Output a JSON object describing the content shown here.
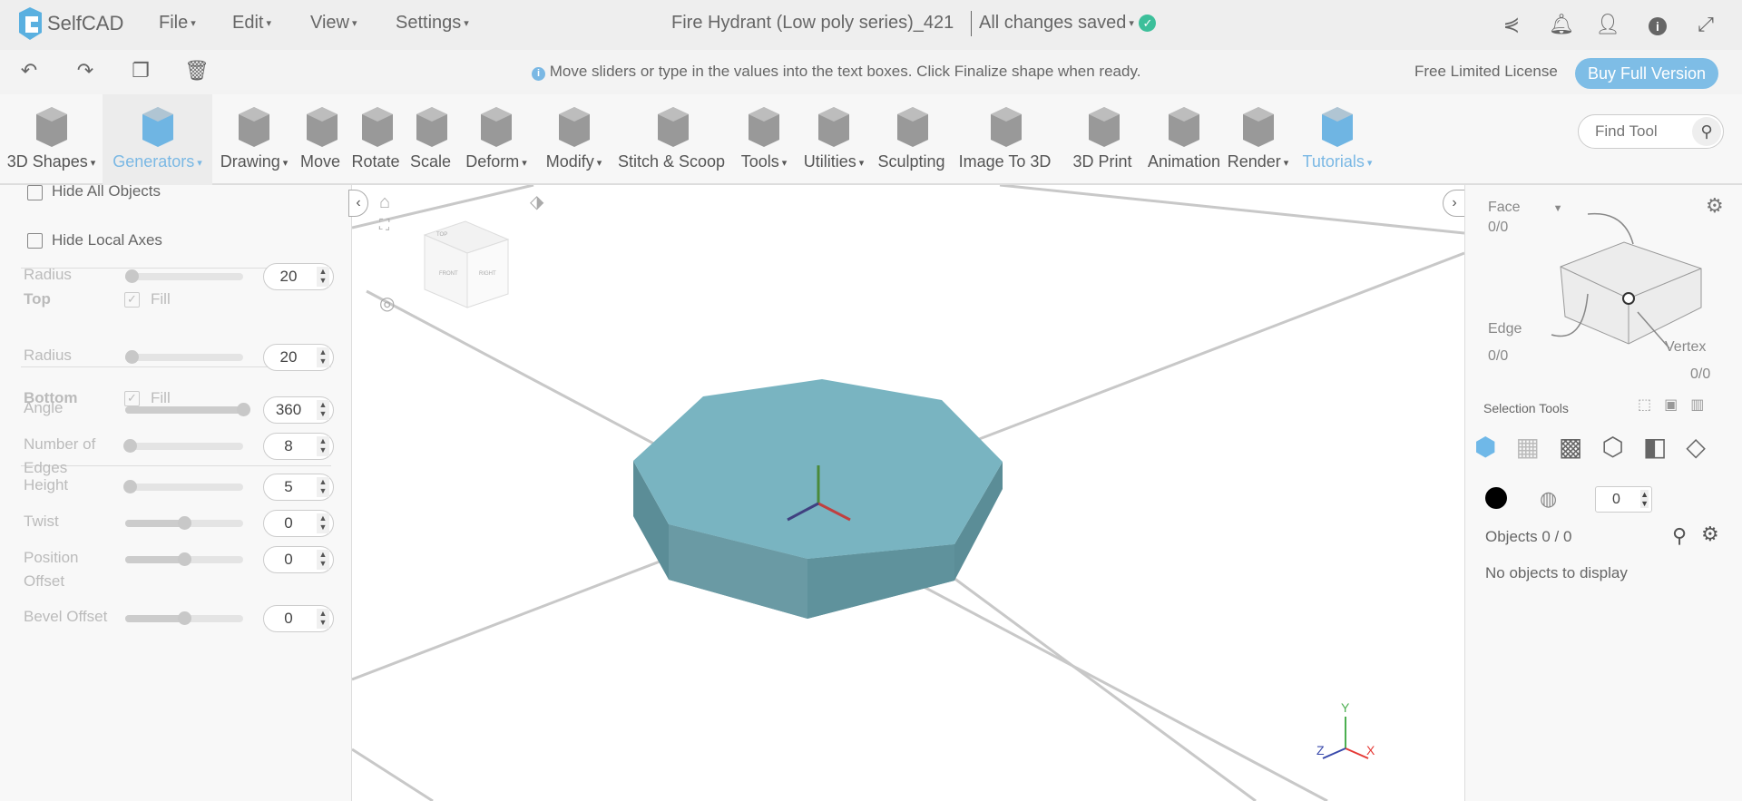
{
  "header": {
    "logo": "SelfCAD",
    "menus": [
      "File",
      "Edit",
      "View",
      "Settings"
    ],
    "doc_title": "Fire Hydrant (Low poly series)_421",
    "save_status": "All changes saved"
  },
  "subbar": {
    "hint": "Move sliders or type in the values into the text boxes. Click Finalize shape when ready.",
    "license": "Free Limited License",
    "buy": "Buy Full Version"
  },
  "toolbar": {
    "tools": [
      {
        "label": "3D Shapes",
        "dd": "▾"
      },
      {
        "label": "Generators",
        "dd": "▾"
      },
      {
        "label": "Drawing",
        "dd": "▾"
      },
      {
        "label": "Move",
        "dd": ""
      },
      {
        "label": "Rotate",
        "dd": ""
      },
      {
        "label": "Scale",
        "dd": ""
      },
      {
        "label": "Deform",
        "dd": "▾"
      },
      {
        "label": "Modify",
        "dd": "▾"
      },
      {
        "label": "Stitch & Scoop",
        "dd": ""
      },
      {
        "label": "Tools",
        "dd": "▾"
      },
      {
        "label": "Utilities",
        "dd": "▾"
      },
      {
        "label": "Sculpting",
        "dd": ""
      },
      {
        "label": "Image To 3D",
        "dd": ""
      },
      {
        "label": "3D Print",
        "dd": ""
      },
      {
        "label": "Animation",
        "dd": ""
      },
      {
        "label": "Render",
        "dd": "▾"
      },
      {
        "label": "Tutorials",
        "dd": "▾"
      }
    ],
    "find_placeholder": "Find Tool"
  },
  "left": {
    "hide_all": "Hide All Objects",
    "hide_axes": "Hide Local Axes",
    "top": "Top",
    "bottom": "Bottom",
    "fill": "Fill",
    "params": [
      {
        "label": "Radius",
        "value": "20",
        "fraction": 0.05
      },
      {
        "label": "Radius",
        "value": "20",
        "fraction": 0.05
      },
      {
        "label": "Angle",
        "value": "360",
        "fraction": 1
      },
      {
        "label": "Number of Edges",
        "value": "8",
        "fraction": 0.04
      },
      {
        "label": "Height",
        "value": "5",
        "fraction": 0
      },
      {
        "label": "Twist",
        "value": "0",
        "fraction": 0.5
      },
      {
        "label": "Position Offset",
        "value": "0",
        "fraction": 0.5
      },
      {
        "label": "Bevel Offset",
        "value": "0",
        "fraction": 0.5
      }
    ]
  },
  "viewport": {
    "axes": {
      "x": "X",
      "y": "Y",
      "z": "Z"
    },
    "cube_labels": [
      "TOP",
      "FRONT",
      "RIGHT"
    ],
    "shape_color": "#79b4c1"
  },
  "right": {
    "face": "Face",
    "face_count": "0/0",
    "edge": "Edge",
    "edge_count": "0/0",
    "vertex": "Vertex",
    "vertex_count": "0/0",
    "selection_tools": "Selection Tools",
    "stepper_value": "0",
    "objects": "Objects 0 / 0",
    "empty": "No objects to display"
  }
}
